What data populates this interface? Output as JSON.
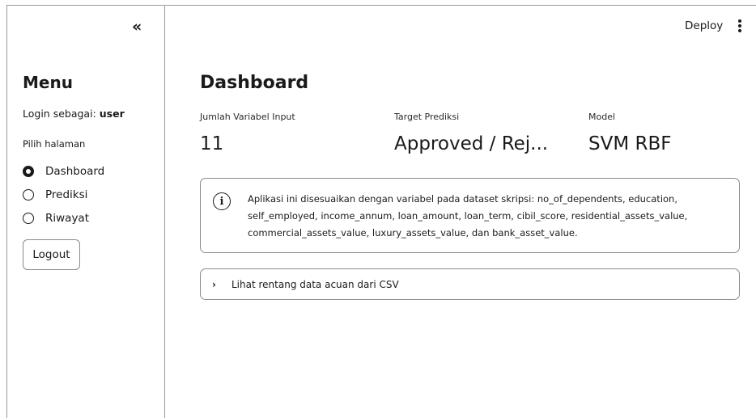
{
  "sidebar": {
    "collapse_icon": "«",
    "menu_title": "Menu",
    "login_prefix": "Login sebagai:",
    "login_user": "user",
    "pilih_label": "Pilih halaman",
    "pages": [
      {
        "label": "Dashboard",
        "selected": true
      },
      {
        "label": "Prediksi",
        "selected": false
      },
      {
        "label": "Riwayat",
        "selected": false
      }
    ],
    "logout_label": "Logout"
  },
  "toolbar": {
    "deploy_label": "Deploy",
    "more_icon": "vertical-dots-icon"
  },
  "main": {
    "title": "Dashboard",
    "metrics": [
      {
        "label": "Jumlah Variabel Input",
        "value": "11"
      },
      {
        "label": "Target Prediksi",
        "value": "Approved / Rej..."
      },
      {
        "label": "Model",
        "value": "SVM RBF"
      }
    ],
    "info_icon": "i",
    "info_text": "Aplikasi ini disesuaikan dengan variabel pada dataset skripsi: no_of_dependents, education, self_employed, income_annum, loan_amount, loan_term, cibil_score, residential_assets_value, commercial_assets_value, luxury_assets_value, dan bank_asset_value.",
    "expander_chevron": "›",
    "expander_label": "Lihat rentang data acuan dari CSV"
  }
}
